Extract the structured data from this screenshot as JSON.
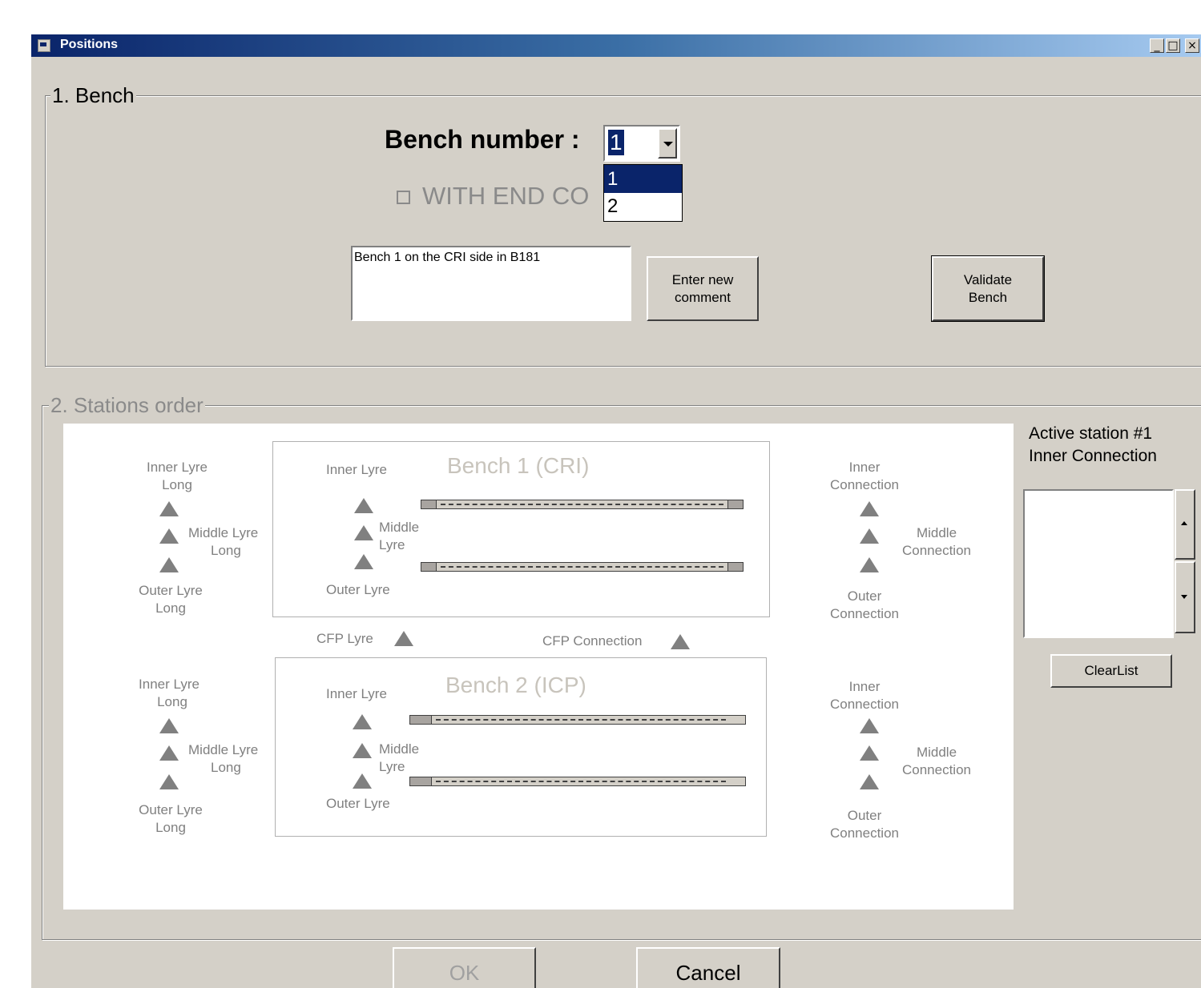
{
  "window": {
    "title": "Positions"
  },
  "bench_group": {
    "legend": "1. Bench",
    "bench_number_label": "Bench number :",
    "bench_number_value": "1",
    "dropdown_options": [
      "1",
      "2"
    ],
    "end_cover_label": "WITH END CO",
    "comment_text": "Bench 1 on the CRI side in B181",
    "enter_comment_label_1": "Enter new",
    "enter_comment_label_2": "comment",
    "validate_label_1": "Validate",
    "validate_label_2": "Bench"
  },
  "stations_group": {
    "legend": "2. Stations order",
    "bench1_title": "Bench 1 (CRI)",
    "bench2_title": "Bench 2 (ICP)",
    "labels": {
      "inner_lyre_long_1": "Inner Lyre",
      "inner_lyre_long_2": "Long",
      "middle_lyre_long_1": "Middle Lyre",
      "middle_lyre_long_2": "Long",
      "outer_lyre_long_1": "Outer Lyre",
      "outer_lyre_long_2": "Long",
      "inner_lyre": "Inner Lyre",
      "middle_lyre_1": "Middle",
      "middle_lyre_2": "Lyre",
      "outer_lyre": "Outer Lyre",
      "inner_connection_1": "Inner",
      "inner_connection_2": "Connection",
      "middle_connection_1": "Middle",
      "middle_connection_2": "Connection",
      "outer_connection_1": "Outer",
      "outer_connection_2": "Connection",
      "cfp_lyre": "CFP Lyre",
      "cfp_connection": "CFP Connection"
    },
    "active_station_line1": "Active station #1",
    "active_station_line2": "Inner Connection",
    "clear_list_label": "ClearList"
  },
  "footer": {
    "ok_label": "OK",
    "cancel_label": "Cancel"
  }
}
